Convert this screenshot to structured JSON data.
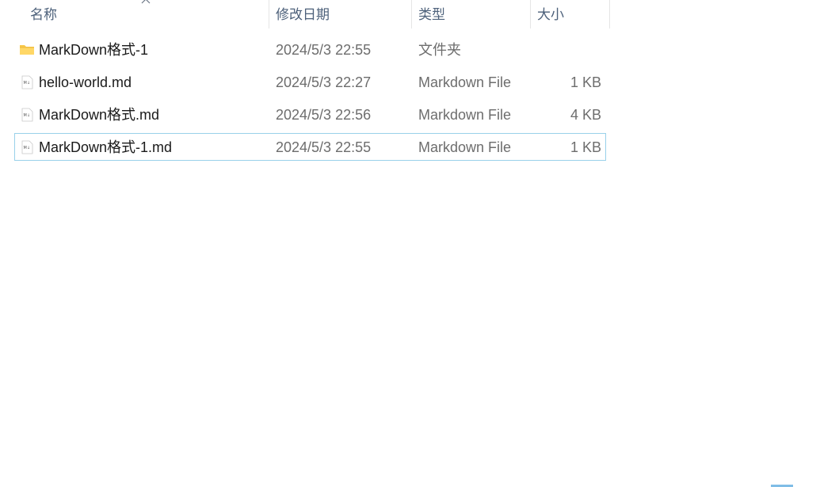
{
  "columns": {
    "name": "名称",
    "date": "修改日期",
    "type": "类型",
    "size": "大小"
  },
  "sort": {
    "column": "name",
    "direction": "ascending",
    "icon": "sort-up-icon"
  },
  "rows": [
    {
      "name": "MarkDown格式-1",
      "date": "2024/5/3 22:55",
      "type": "文件夹",
      "size": "",
      "icon": "folder-icon",
      "focused": false
    },
    {
      "name": "hello-world.md",
      "date": "2024/5/3 22:27",
      "type": "Markdown File",
      "size": "1 KB",
      "icon": "markdown-file-icon",
      "focused": false
    },
    {
      "name": "MarkDown格式.md",
      "date": "2024/5/3 22:56",
      "type": "Markdown File",
      "size": "4 KB",
      "icon": "markdown-file-icon",
      "focused": false
    },
    {
      "name": "MarkDown格式-1.md",
      "date": "2024/5/3 22:55",
      "type": "Markdown File",
      "size": "1 KB",
      "icon": "markdown-file-icon",
      "focused": true
    }
  ],
  "colors": {
    "header_text": "#4c607a",
    "focus_border": "#99d1ea",
    "folder": "#f8c84a"
  }
}
